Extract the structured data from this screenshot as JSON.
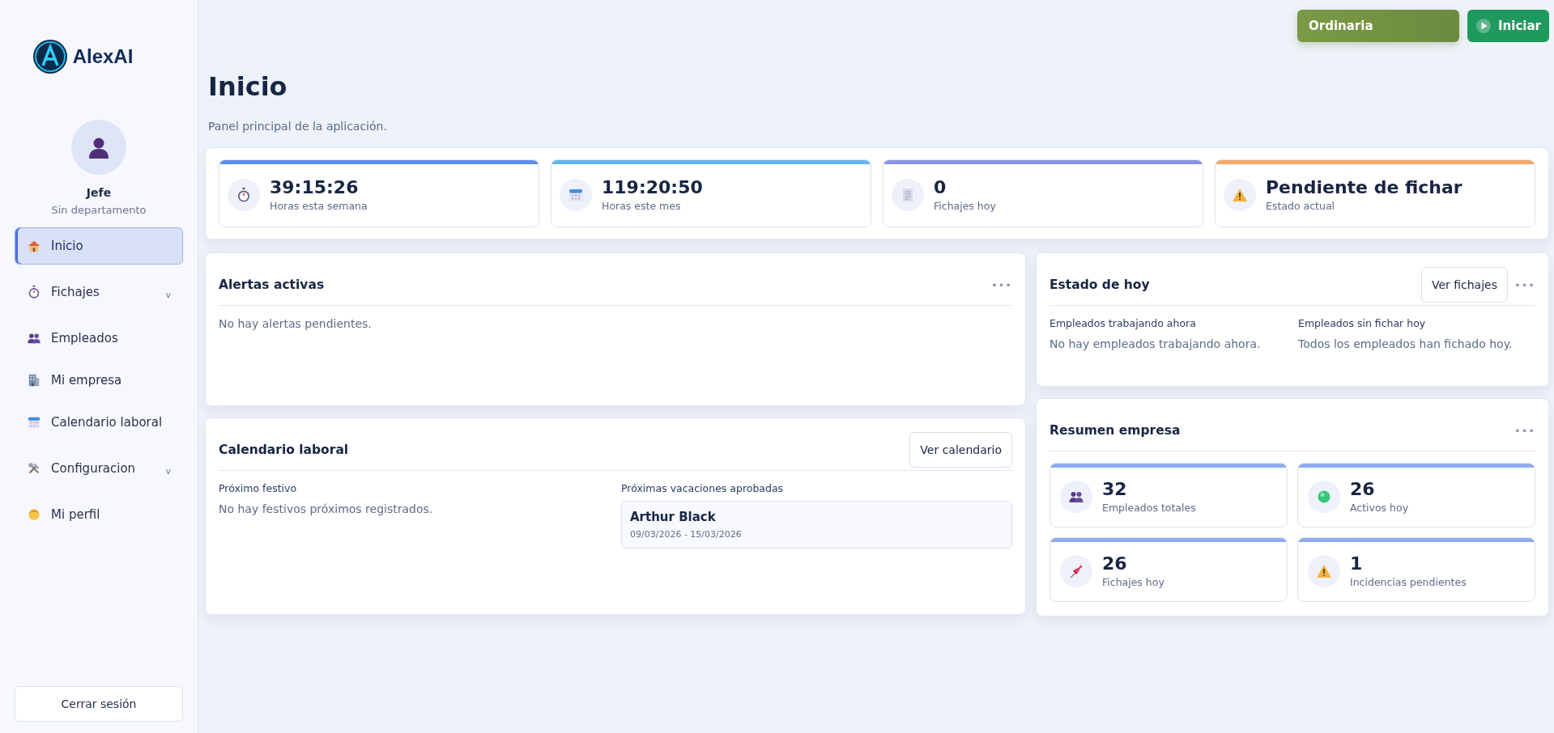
{
  "brand": {
    "name": "AlexAI"
  },
  "user": {
    "name": "Jefe",
    "department": "Sin departamento"
  },
  "sidebar": {
    "items": [
      {
        "label": "Inicio",
        "selected": true
      },
      {
        "label": "Fichajes",
        "selected": false,
        "caret": "v"
      },
      {
        "label": "Empleados",
        "selected": false
      },
      {
        "label": "Mi empresa",
        "selected": false
      },
      {
        "label": "Calendario laboral",
        "selected": false
      },
      {
        "label": "Configuracion",
        "selected": false,
        "caret": "v"
      },
      {
        "label": "Mi perfil",
        "selected": false
      }
    ],
    "logout": "Cerrar sesión"
  },
  "topbar": {
    "shift": "Ordinaria",
    "start": "Iniciar"
  },
  "page": {
    "title": "Inicio",
    "subtitle": "Panel principal de la aplicación."
  },
  "stats": [
    {
      "value": "39:15:26",
      "label": "Horas esta semana",
      "color": "#5b8def"
    },
    {
      "value": "119:20:50",
      "label": "Horas este mes",
      "color": "#64b5f0"
    },
    {
      "value": "0",
      "label": "Fichajes hoy",
      "color": "#8b93e6"
    },
    {
      "value": "Pendiente de fichar",
      "label": "Estado actual",
      "color": "#f4a86a"
    }
  ],
  "alerts": {
    "title": "Alertas activas",
    "more": "•••",
    "empty": "No hay alertas pendientes."
  },
  "calendar": {
    "title": "Calendario laboral",
    "button": "Ver calendario",
    "holiday_label": "Próximo festivo",
    "holiday_empty": "No hay festivos próximos registrados.",
    "vacations_label": "Próximas vacaciones aprobadas",
    "vacations": [
      {
        "name": "Arthur Black",
        "dates": "09/03/2026 - 15/03/2026"
      }
    ]
  },
  "today": {
    "title": "Estado de hoy",
    "button": "Ver fichajes",
    "more": "•••",
    "columns": [
      {
        "label": "Empleados trabajando ahora",
        "text": "No hay empleados trabajando ahora."
      },
      {
        "label": "Empleados sin fichar hoy",
        "text": "Todos los empleados han fichado hoy."
      }
    ]
  },
  "summary": {
    "title": "Resumen empresa",
    "more": "•••",
    "items": [
      {
        "value": "32",
        "label": "Empleados totales"
      },
      {
        "value": "26",
        "label": "Activos hoy"
      },
      {
        "value": "26",
        "label": "Fichajes hoy"
      },
      {
        "value": "1",
        "label": "Incidencias pendientes"
      }
    ]
  }
}
